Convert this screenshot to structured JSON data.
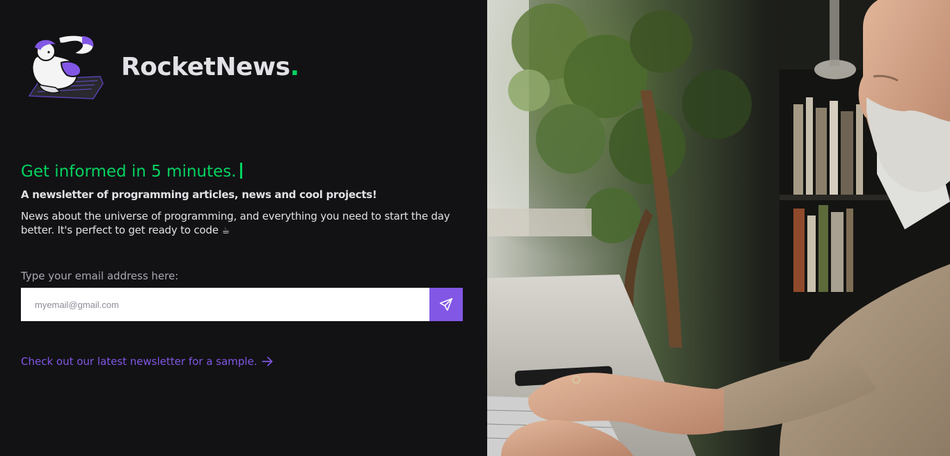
{
  "brand": {
    "name": "RocketNews",
    "dot": ".",
    "accent_color": "#04d361",
    "logo_icon": "mascot-coding-icon"
  },
  "hero": {
    "headline": "Get informed in 5 minutes.",
    "subheadline": "A newsletter of programming articles, news and cool projects!",
    "description": "News about the universe of programming, and everything you need to start the day better. It's perfect to get ready to code",
    "description_emoji": "☕"
  },
  "signup": {
    "label": "Type your email address here:",
    "placeholder": "myemail@gmail.com",
    "value": "",
    "submit_icon": "send-icon",
    "button_color": "#8257e5"
  },
  "sample": {
    "link_text": "Check out our latest newsletter for a sample.",
    "link_icon": "arrow-right-icon",
    "link_color": "#8257e5"
  },
  "photo": {
    "description_icon": "hero-photo"
  }
}
